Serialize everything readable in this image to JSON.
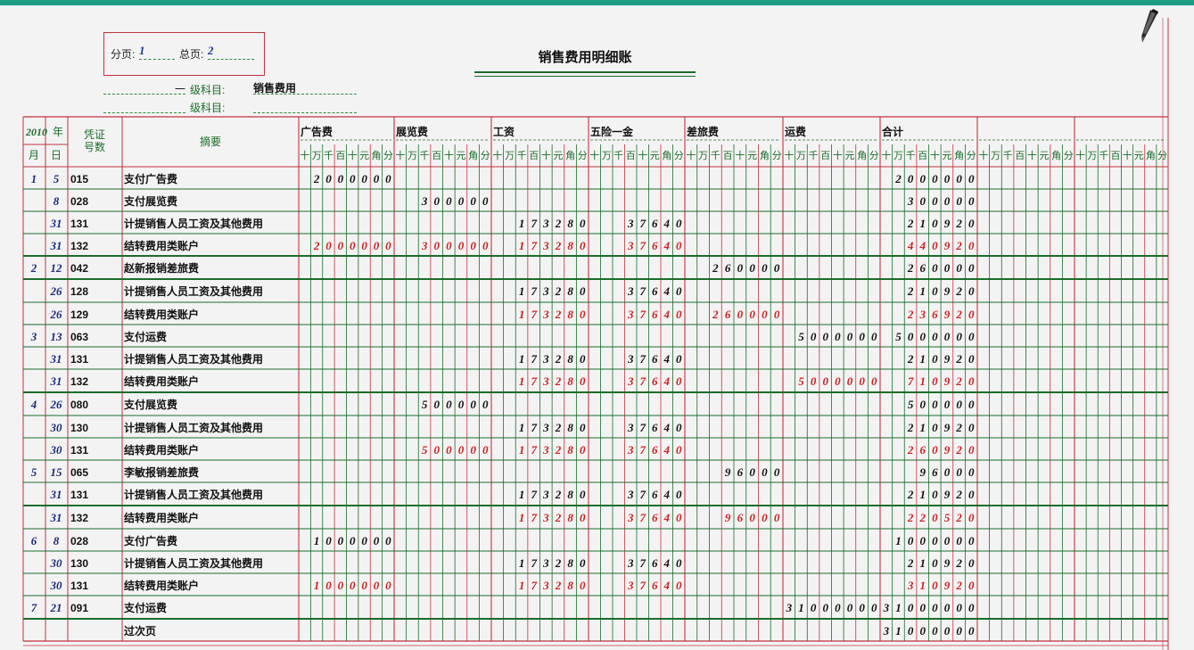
{
  "page_box": {
    "page_label": "分页:",
    "page_value": "1",
    "total_label": "总页:",
    "total_value": "2"
  },
  "title": "销售费用明细账",
  "account": {
    "level1_prefix": "一",
    "level1_label": "级科目:",
    "level1_value": "销售费用",
    "level2_label": "级科目:",
    "level2_value": ""
  },
  "header": {
    "year": "2010",
    "year_suffix": "年",
    "month": "月",
    "day": "日",
    "voucher_line1": "凭证",
    "voucher_line2": "号数",
    "summary": "摘要",
    "digit_labels": [
      "十",
      "万",
      "千",
      "百",
      "十",
      "元",
      "角",
      "分"
    ],
    "columns": [
      "广告费",
      "展览费",
      "工资",
      "五险一金",
      "差旅费",
      "运费",
      "合计",
      "",
      ""
    ]
  },
  "rows": [
    {
      "month": "1",
      "day": "5",
      "voucher": "015",
      "summary": "支付广告费",
      "values": [
        "2000000",
        "",
        "",
        "",
        "",
        "",
        "2000000"
      ],
      "red": false
    },
    {
      "month": "",
      "day": "8",
      "voucher": "028",
      "summary": "支付展览费",
      "values": [
        "",
        "300000",
        "",
        "",
        "",
        "",
        "300000"
      ],
      "red": false
    },
    {
      "month": "",
      "day": "31",
      "voucher": "131",
      "summary": "计提销售人员工资及其他费用",
      "values": [
        "",
        "",
        "173280",
        "37640",
        "",
        "",
        "210920"
      ],
      "red": false
    },
    {
      "month": "",
      "day": "31",
      "voucher": "132",
      "summary": "结转费用类账户",
      "values": [
        "2000000",
        "300000",
        "173280",
        "37640",
        "",
        "",
        "440920"
      ],
      "red": true
    },
    {
      "month": "2",
      "day": "12",
      "voucher": "042",
      "summary": "赵新报销差旅费",
      "values": [
        "",
        "",
        "",
        "",
        "260000",
        "",
        "260000"
      ],
      "red": false
    },
    {
      "month": "",
      "day": "26",
      "voucher": "128",
      "summary": "计提销售人员工资及其他费用",
      "values": [
        "",
        "",
        "173280",
        "37640",
        "",
        "",
        "210920"
      ],
      "red": false
    },
    {
      "month": "",
      "day": "26",
      "voucher": "129",
      "summary": "结转费用类账户",
      "values": [
        "",
        "",
        "173280",
        "37640",
        "260000",
        "",
        "236920"
      ],
      "red": true
    },
    {
      "month": "3",
      "day": "13",
      "voucher": "063",
      "summary": "支付运费",
      "values": [
        "",
        "",
        "",
        "",
        "",
        "5000000",
        "5000000"
      ],
      "red": false
    },
    {
      "month": "",
      "day": "31",
      "voucher": "131",
      "summary": "计提销售人员工资及其他费用",
      "values": [
        "",
        "",
        "173280",
        "37640",
        "",
        "",
        "210920"
      ],
      "red": false
    },
    {
      "month": "",
      "day": "31",
      "voucher": "132",
      "summary": "结转费用类账户",
      "values": [
        "",
        "",
        "173280",
        "37640",
        "",
        "5000000",
        "710920"
      ],
      "red": true
    },
    {
      "month": "4",
      "day": "26",
      "voucher": "080",
      "summary": "支付展览费",
      "values": [
        "",
        "500000",
        "",
        "",
        "",
        "",
        "500000"
      ],
      "red": false
    },
    {
      "month": "",
      "day": "30",
      "voucher": "130",
      "summary": "计提销售人员工资及其他费用",
      "values": [
        "",
        "",
        "173280",
        "37640",
        "",
        "",
        "210920"
      ],
      "red": false
    },
    {
      "month": "",
      "day": "30",
      "voucher": "131",
      "summary": "结转费用类账户",
      "values": [
        "",
        "500000",
        "173280",
        "37640",
        "",
        "",
        "260920"
      ],
      "red": true
    },
    {
      "month": "5",
      "day": "15",
      "voucher": "065",
      "summary": "李敏报销差旅费",
      "values": [
        "",
        "",
        "",
        "",
        "96000",
        "",
        "96000"
      ],
      "red": false
    },
    {
      "month": "",
      "day": "31",
      "voucher": "131",
      "summary": "计提销售人员工资及其他费用",
      "values": [
        "",
        "",
        "173280",
        "37640",
        "",
        "",
        "210920"
      ],
      "red": false
    },
    {
      "month": "",
      "day": "31",
      "voucher": "132",
      "summary": "结转费用类账户",
      "values": [
        "",
        "",
        "173280",
        "37640",
        "96000",
        "",
        "220520"
      ],
      "red": true
    },
    {
      "month": "6",
      "day": "8",
      "voucher": "028",
      "summary": "支付广告费",
      "values": [
        "1000000",
        "",
        "",
        "",
        "",
        "",
        "1000000"
      ],
      "red": false
    },
    {
      "month": "",
      "day": "30",
      "voucher": "130",
      "summary": "计提销售人员工资及其他费用",
      "values": [
        "",
        "",
        "173280",
        "37640",
        "",
        "",
        "210920"
      ],
      "red": false
    },
    {
      "month": "",
      "day": "30",
      "voucher": "131",
      "summary": "结转费用类账户",
      "values": [
        "1000000",
        "",
        "173280",
        "37640",
        "",
        "",
        "310920"
      ],
      "red": true
    },
    {
      "month": "7",
      "day": "21",
      "voucher": "091",
      "summary": "支付运费",
      "values": [
        "",
        "",
        "",
        "",
        "",
        "31000000",
        "31000000"
      ],
      "red": false
    },
    {
      "month": "",
      "day": "",
      "voucher": "",
      "summary": "过次页",
      "values": [
        "",
        "",
        "",
        "",
        "",
        "",
        "31000000"
      ],
      "red": false
    }
  ],
  "colors": {
    "red": "#cc1f1f",
    "green": "#1a6d28",
    "frame_red": "#c0333d",
    "topbar": "#1e9c84"
  },
  "icons": [
    "pen-icon"
  ]
}
